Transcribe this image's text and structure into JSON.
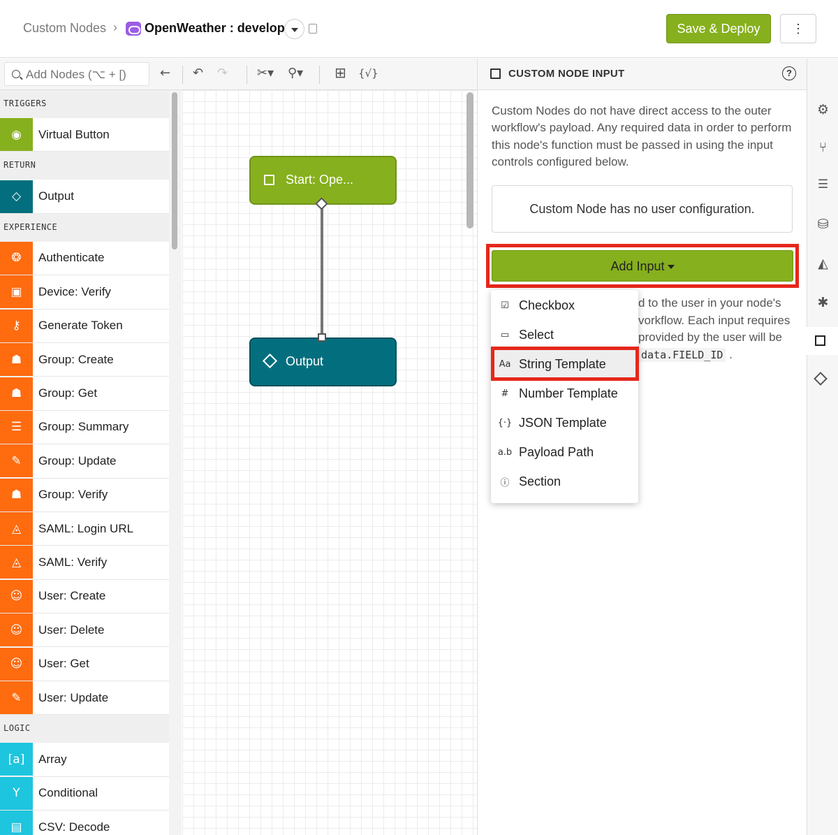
{
  "header": {
    "breadcrumb_root": "Custom Nodes",
    "breadcrumb_sep": "›",
    "app_name": "OpenWeather : develop",
    "save_deploy_label": "Save & Deploy",
    "more_label": "⋮"
  },
  "toolbar": {
    "search_placeholder": "Add Nodes (⌥ + [)",
    "json_toggle_label": "{√}"
  },
  "palette": {
    "categories": [
      {
        "label": "TRIGGERS",
        "items": [
          {
            "label": "Virtual Button",
            "icon": "target-icon",
            "color": "#86b01d"
          }
        ]
      },
      {
        "label": "RETURN",
        "items": [
          {
            "label": "Output",
            "icon": "diamond-icon",
            "color": "#036f7e"
          }
        ]
      },
      {
        "label": "EXPERIENCE",
        "items": [
          {
            "label": "Authenticate",
            "icon": "fingerprint-icon",
            "color": "#ff6b0f"
          },
          {
            "label": "Device: Verify",
            "icon": "chip-icon",
            "color": "#ff6b0f"
          },
          {
            "label": "Generate Token",
            "icon": "key-icon",
            "color": "#ff6b0f"
          },
          {
            "label": "Group: Create",
            "icon": "group-add-icon",
            "color": "#ff6b0f"
          },
          {
            "label": "Group: Get",
            "icon": "group-search-icon",
            "color": "#ff6b0f"
          },
          {
            "label": "Group: Summary",
            "icon": "group-list-icon",
            "color": "#ff6b0f"
          },
          {
            "label": "Group: Update",
            "icon": "group-edit-icon",
            "color": "#ff6b0f"
          },
          {
            "label": "Group: Verify",
            "icon": "group-verify-icon",
            "color": "#ff6b0f"
          },
          {
            "label": "SAML: Login URL",
            "icon": "saml-icon",
            "color": "#ff6b0f"
          },
          {
            "label": "SAML: Verify",
            "icon": "saml-icon",
            "color": "#ff6b0f"
          },
          {
            "label": "User: Create",
            "icon": "user-add-icon",
            "color": "#ff6b0f"
          },
          {
            "label": "User: Delete",
            "icon": "user-remove-icon",
            "color": "#ff6b0f"
          },
          {
            "label": "User: Get",
            "icon": "user-search-icon",
            "color": "#ff6b0f"
          },
          {
            "label": "User: Update",
            "icon": "user-edit-icon",
            "color": "#ff6b0f"
          }
        ]
      },
      {
        "label": "LOGIC",
        "items": [
          {
            "label": "Array",
            "icon": "array-icon",
            "color": "#1ec5de"
          },
          {
            "label": "Conditional",
            "icon": "branch-icon",
            "color": "#1ec5de"
          },
          {
            "label": "CSV: Decode",
            "icon": "csv-icon",
            "color": "#1ec5de"
          }
        ]
      }
    ]
  },
  "canvas": {
    "start_node_label": "Start: Ope...",
    "output_node_label": "Output"
  },
  "panel": {
    "title": "CUSTOM NODE INPUT",
    "help": "?",
    "description": "Custom Nodes do not have direct access to the outer workflow's payload. Any required data in order to perform this node's function must be passed in using the input controls configured below.",
    "empty_message": "Custom Node has no user configuration.",
    "add_input_label": "Add Input",
    "partial_line_1": "d to the user in your node's",
    "partial_line_2": "vorkflow. Each input requires",
    "partial_line_3": "provided by the user will be",
    "code_sample": "data.FIELD_ID",
    "code_after": " ."
  },
  "dropdown": {
    "items": [
      {
        "label": "Checkbox",
        "icon": "checkbox-icon"
      },
      {
        "label": "Select",
        "icon": "select-icon"
      },
      {
        "label": "String Template",
        "icon": "string-icon"
      },
      {
        "label": "Number Template",
        "icon": "hash-icon"
      },
      {
        "label": "JSON Template",
        "icon": "json-icon"
      },
      {
        "label": "Payload Path",
        "icon": "path-icon"
      },
      {
        "label": "Section",
        "icon": "info-icon"
      }
    ]
  },
  "colors": {
    "accent_green": "#86b01d",
    "output_teal": "#036f7e",
    "experience_orange": "#ff6b0f",
    "logic_cyan": "#1ec5de",
    "highlight_red": "#e6271b"
  }
}
